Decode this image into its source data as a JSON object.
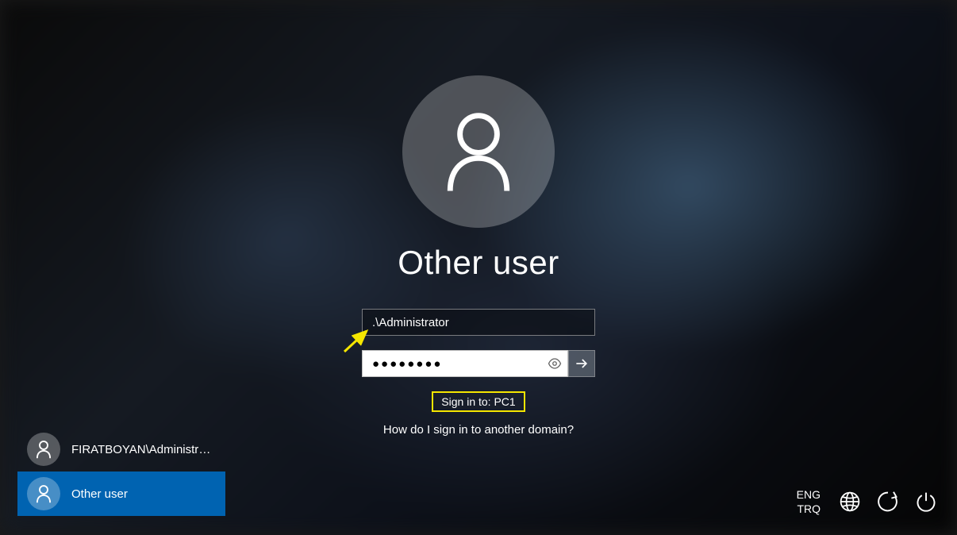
{
  "login": {
    "title": "Other user",
    "username_value": ".\\Administrator",
    "password_value": "●●●●●●●●",
    "signin_to": "Sign in to: PC1",
    "domain_link": "How do I sign in to another domain?"
  },
  "users": [
    {
      "label": "FIRATBOYAN\\Administrat...",
      "selected": false
    },
    {
      "label": "Other user",
      "selected": true
    }
  ],
  "system": {
    "lang1": "ENG",
    "lang2": "TRQ"
  }
}
